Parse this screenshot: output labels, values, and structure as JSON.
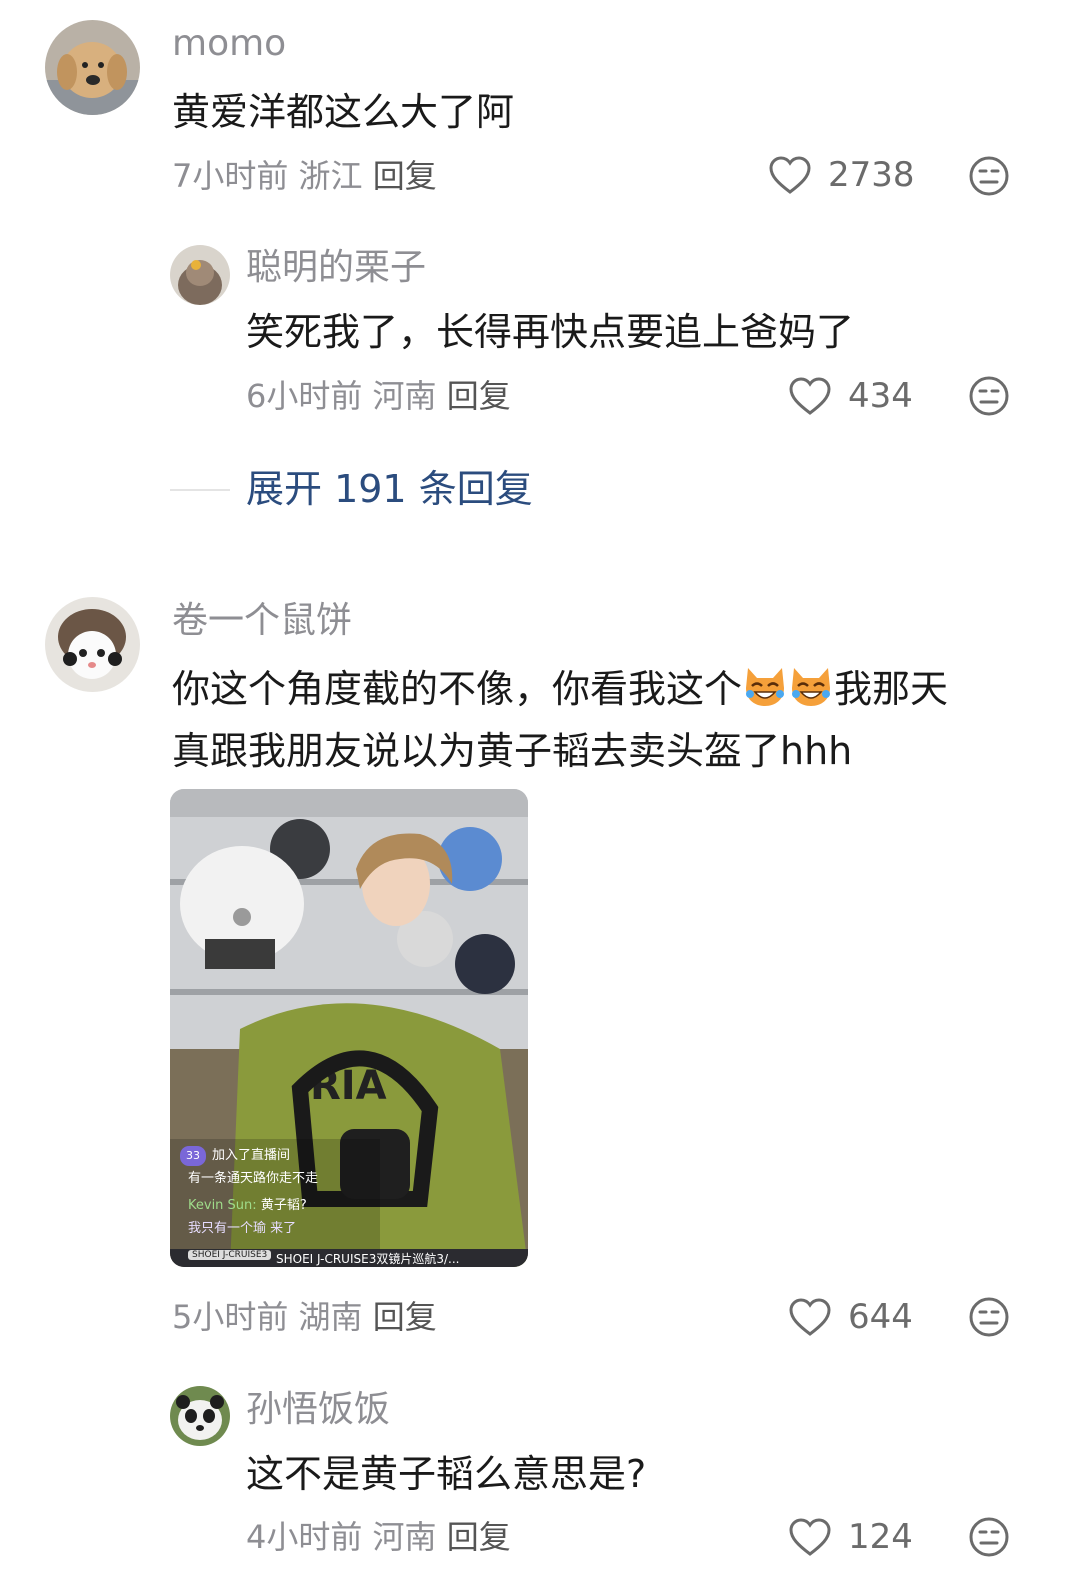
{
  "comments": [
    {
      "username": "momo",
      "text": "黄爱洋都这么大了阿",
      "time": "7小时前",
      "location": "浙江",
      "reply_label": "回复",
      "likes": "2738"
    },
    {
      "username": "聪明的栗子",
      "text": "笑死我了，长得再快点要追上爸妈了",
      "time": "6小时前",
      "location": "河南",
      "reply_label": "回复",
      "likes": "434"
    },
    {
      "username": "卷一个鼠饼",
      "text_line1": "你这个角度截的不像，你看我这个",
      "text_after_emoji": "我那天",
      "text_line2": "真跟我朋友说以为黄子韬去卖头盔了hhh",
      "time": "5小时前",
      "location": "湖南",
      "reply_label": "回复",
      "likes": "644",
      "image": {
        "overlay_badge": "33",
        "overlay_line1": "加入了直播间",
        "overlay_line2": "有一条通天路你走不走",
        "overlay_line3_user": "Kevin Sun:",
        "overlay_line3_text": "黄子韬?",
        "overlay_line4": "我只有一个瑜 来了",
        "bottom_tag": "SHOEI J-CRUISE3",
        "bottom_title": "SHOEI J-CRUISE3双镜片巡航3/..."
      }
    },
    {
      "username": "孙悟饭饭",
      "text": "这不是黄子韬么意思是?",
      "time": "4小时前",
      "location": "河南",
      "reply_label": "回复",
      "likes": "124"
    }
  ],
  "expand_replies": "展开 191 条回复",
  "icons": {
    "like": "heart-outline-icon",
    "dislike": "meh-face-icon",
    "emoji": "laughing-cat-emoji"
  },
  "colors": {
    "username": "#8e8e93",
    "text": "#1a1a1a",
    "expand_link": "#2b4c7e",
    "icon": "#6b6b6b"
  }
}
